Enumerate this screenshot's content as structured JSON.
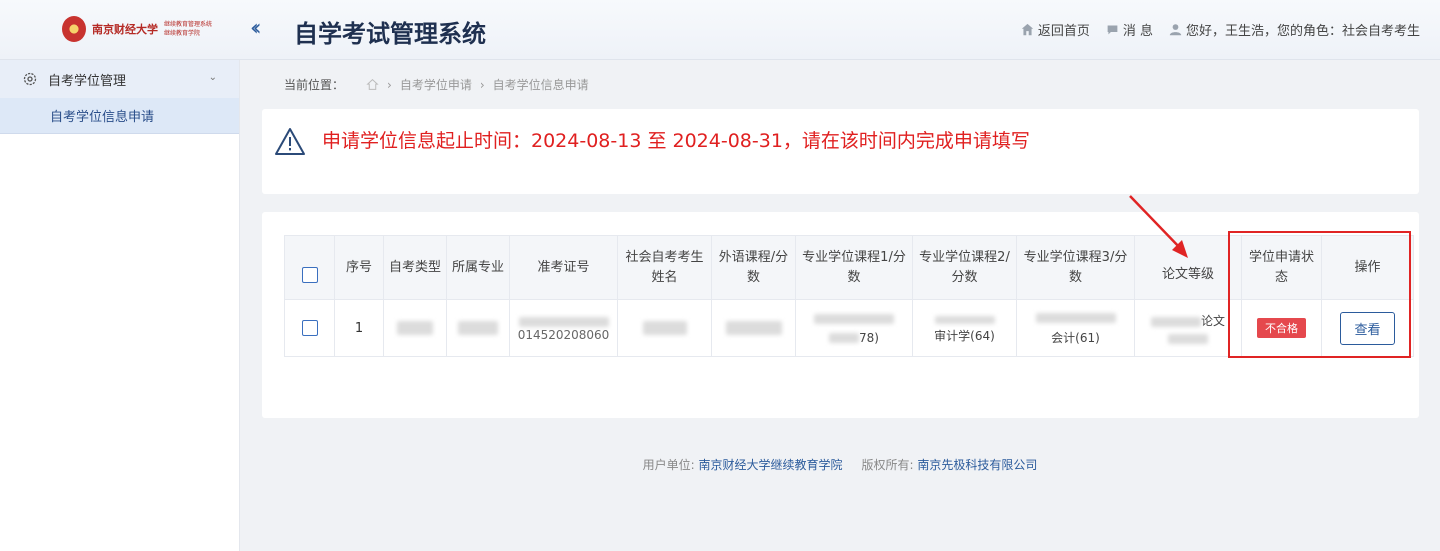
{
  "header": {
    "logo_name": "南京财经大学",
    "logo_sub_1": "继续教育管理系统",
    "logo_sub_2": "继续教育学院",
    "title": "自学考试管理系统",
    "home_label": "返回首页",
    "messages_label": "消 息",
    "user_greeting": "您好，王生浩，您的角色：社会自考考生"
  },
  "sidebar": {
    "group_label": "自考学位管理",
    "items": [
      {
        "label": "自考学位信息申请"
      }
    ]
  },
  "breadcrumb": {
    "label": "当前位置：",
    "items": [
      "自考学位申请",
      "自考学位信息申请"
    ]
  },
  "notice": {
    "text": "申请学位信息起止时间：2024-08-13 至 2024-08-31，请在该时间内完成申请填写"
  },
  "table": {
    "headers": [
      "序号",
      "自考类型",
      "所属专业",
      "准考证号",
      "社会自考考生姓名",
      "外语课程/分数",
      "专业学位课程1/分数",
      "专业学位课程2/分数",
      "专业学位课程3/分数",
      "论文等级",
      "学位申请状态",
      "操作"
    ],
    "rows": [
      {
        "index": "1",
        "exam_no_partial": "014520208060",
        "course1_partial": "78)",
        "course2_partial": "审计学(64)",
        "course3_partial": "会计(61)",
        "thesis_partial": "论文",
        "status": "不合格",
        "action": "查看"
      }
    ]
  },
  "footer": {
    "org_label": "用户单位:",
    "org_name": "南京财经大学继续教育学院",
    "copyright_label": "版权所有:",
    "copyright_name": "南京先极科技有限公司"
  },
  "colors": {
    "accent": "#2b5b9c",
    "alert": "#e02020",
    "badge": "#e5484d"
  }
}
